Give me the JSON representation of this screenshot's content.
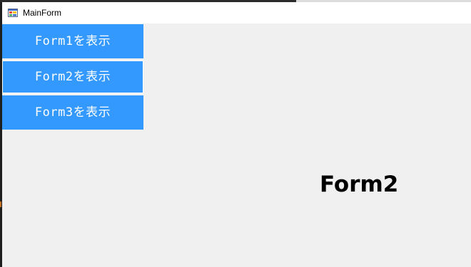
{
  "window": {
    "title": "MainForm",
    "icon": "app-form-icon"
  },
  "sidebar": {
    "buttons": [
      {
        "label": "Form1を表示"
      },
      {
        "label": "Form2を表示"
      },
      {
        "label": "Form3を表示"
      }
    ]
  },
  "main": {
    "content_label": "Form2"
  },
  "colors": {
    "button_bg": "#3399ff",
    "button_text": "#ffffff",
    "client_bg": "#f0f0f0",
    "titlebar_bg": "#ffffff"
  }
}
